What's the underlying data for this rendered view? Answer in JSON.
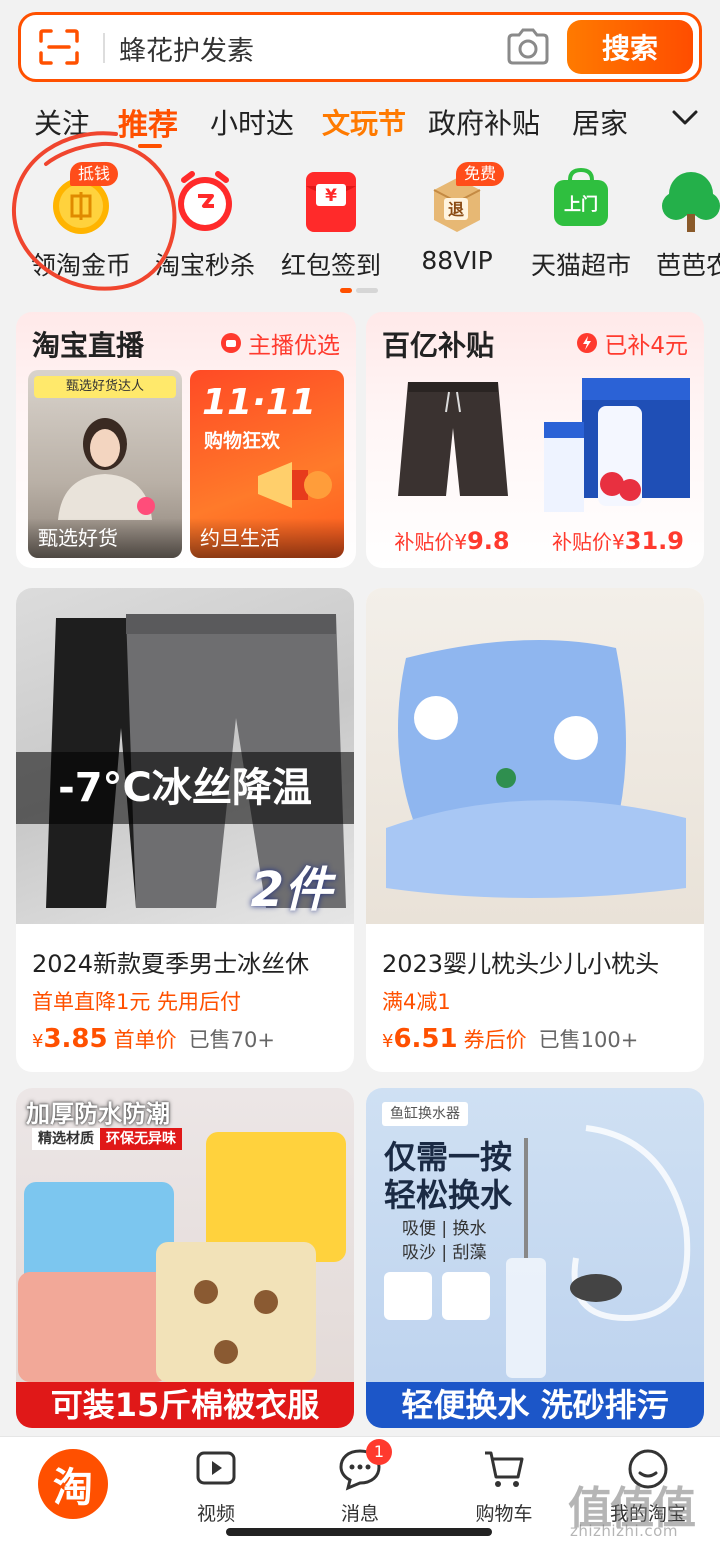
{
  "search": {
    "value": "蜂花护发素",
    "button_label": "搜索",
    "scan_icon": "scan-icon",
    "camera_icon": "camera-icon"
  },
  "tabs": [
    {
      "label": "关注"
    },
    {
      "label": "推荐",
      "active": true
    },
    {
      "label": "小时达"
    },
    {
      "label": "文玩节"
    },
    {
      "label": "政府补贴"
    },
    {
      "label": "居家"
    }
  ],
  "shortcuts": [
    {
      "label": "领淘金币",
      "badge": "抵钱",
      "icon": "gold-coin-icon"
    },
    {
      "label": "淘宝秒杀",
      "icon": "flash-sale-clock-icon"
    },
    {
      "label": "红包签到",
      "icon": "red-packet-icon"
    },
    {
      "label": "88VIP",
      "badge": "免费",
      "icon": "return-box-icon"
    },
    {
      "label": "天猫超市",
      "icon": "tmall-shopping-bag-icon"
    },
    {
      "label": "芭芭农",
      "icon": "tree-icon"
    }
  ],
  "live": {
    "title": "淘宝直播",
    "tag": "主播优选",
    "items": [
      {
        "caption": "甄选好货",
        "banner": "甄选好货达人"
      },
      {
        "caption": "约旦生活",
        "poster_title": "11·11",
        "poster_subtitle": "购物狂欢"
      }
    ]
  },
  "subsidy": {
    "title": "百亿补贴",
    "tag": "已补4元",
    "items": [
      {
        "price_label": "补贴价",
        "currency": "¥",
        "price": "9.8"
      },
      {
        "price_label": "补贴价",
        "currency": "¥",
        "price": "31.9"
      }
    ]
  },
  "products": [
    {
      "name": "2024新款夏季男士冰丝休",
      "promo": "首单直降1元 先用后付",
      "currency": "¥",
      "price": "3.85",
      "price_type": "首单价",
      "sold": "已售70+",
      "overlay_main": "-7°C冰丝降温",
      "overlay_sub": "2件"
    },
    {
      "name": "2023婴儿枕头少儿小枕头",
      "promo": "满4减1",
      "currency": "¥",
      "price": "6.51",
      "price_type": "券后价",
      "sold": "已售100+"
    },
    {
      "headline": "加厚防水防潮",
      "chip_a": "精选材质",
      "chip_b": "环保无异味",
      "banner": "可装15斤棉被衣服"
    },
    {
      "chip": "鱼缸换水器",
      "headline_1": "仅需一按",
      "headline_2": "轻松换水",
      "features": [
        "吸便 | 换水",
        "吸沙 | 刮藻"
      ],
      "banner": "轻便换水 洗砂排污"
    }
  ],
  "bottom_nav": [
    {
      "label": "淘",
      "icon": "taobao-home-icon"
    },
    {
      "label": "视频",
      "icon": "video-play-icon"
    },
    {
      "label": "消息",
      "icon": "message-bubble-icon",
      "badge": "1"
    },
    {
      "label": "购物车",
      "icon": "cart-icon"
    },
    {
      "label": "我的淘宝",
      "icon": "profile-icon"
    }
  ],
  "watermark": {
    "big": "值值值",
    "small": "zhizhizhi.com"
  },
  "colors": {
    "brand": "#ff5000",
    "price": "#ff3a2e",
    "annotation": "#f0452e"
  }
}
